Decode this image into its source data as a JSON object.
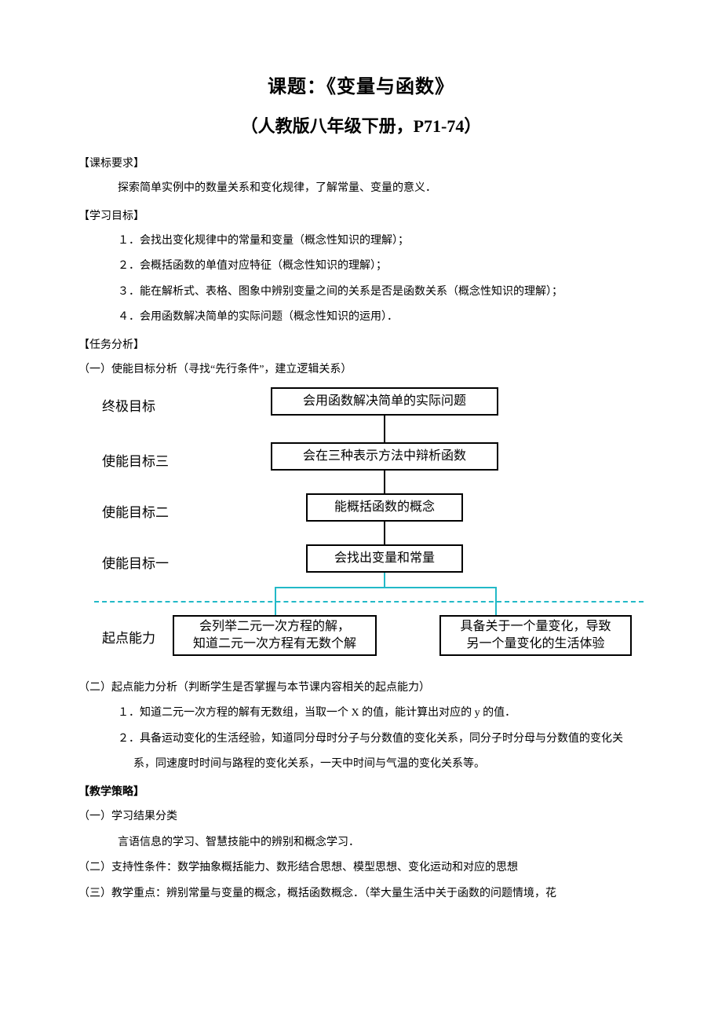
{
  "title_main": "课题：《变量与函数》",
  "title_sub": "（人教版八年级下册，P71-74）",
  "sec1_heading": "【课标要求】",
  "sec1_text": "探索简单实例中的数量关系和变化规律，了解常量、变量的意义．",
  "sec2_heading": "【学习目标】",
  "sec2_items": {
    "0": "１．会找出变化规律中的常量和变量（概念性知识的理解）；",
    "1": "２．会概括函数的单值对应特征（概念性知识的理解）；",
    "2": "３．能在解析式、表格、图象中辨别变量之间的关系是否是函数关系（概念性知识的理解）；",
    "3": "４．会用函数解决简单的实际问题（概念性知识的运用）．"
  },
  "sec3_heading": "【任务分析】",
  "sec3_sub1": "（一）使能目标分析（寻找“先行条件”，建立逻辑关系）",
  "diagram": {
    "label_top": "终极目标",
    "label_g3": "使能目标三",
    "label_g2": "使能目标二",
    "label_g1": "使能目标一",
    "label_start": "起点能力",
    "box_top": "会用函数解决简单的实际问题",
    "box_g3": "会在三种表示方法中辩析函数",
    "box_g2": "能概括函数的概念",
    "box_g1": "会找出变量和常量",
    "box_start_l": "会列举二元一次方程的解，\n知道二元一次方程有无数个解",
    "box_start_r": "具备关于一个量变化，导致\n另一个量变化的生活体验"
  },
  "sec3_sub2": "（二）起点能力分析（判断学生是否掌握与本节课内容相关的起点能力）",
  "sec3_sub2_items": {
    "0": "１．知道二元一次方程的解有无数组，当取一个 X 的值，能计算出对应的 y 的值．",
    "1": "２．具备运动变化的生活经验，知道同分母时分子与分数值的变化关系，同分子时分母与分数值的变化关",
    "1b": "系，同速度时时间与路程的变化关系，一天中时间与气温的变化关系等。"
  },
  "sec4_heading": "【教学策略】",
  "sec4_sub1": "（一）学习结果分类",
  "sec4_sub1_text": "言语信息的学习、智慧技能中的辨别和概念学习．",
  "sec4_sub2": "（二）支持性条件：数学抽象概括能力、数形结合思想、模型思想、变化运动和对应的思想",
  "sec4_sub3": "（三）教学重点：辨别常量与变量的概念，概括函数概念．（举大量生活中关于函数的问题情境，花"
}
